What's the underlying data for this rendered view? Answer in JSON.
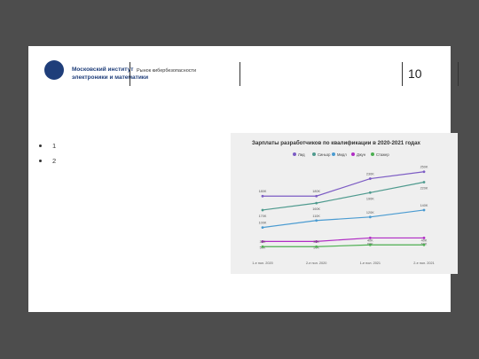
{
  "header": {
    "org_line1": "Московский институт",
    "org_line2": "электроники и математики",
    "topic": "Рынок кибербезопасности",
    "page_number": "10"
  },
  "bullets": [
    "1",
    "2"
  ],
  "chart_data": {
    "type": "line",
    "title": "Зарплаты разработчиков по квалификации в 2020-2021 годах",
    "categories": [
      "1-е пол. 2020",
      "2-е пол. 2020",
      "1-е пол. 2021",
      "2-е пол. 2021"
    ],
    "series": [
      {
        "name": "Лид",
        "color": "#7c5cc4",
        "values": [
          180,
          180,
          230,
          250
        ],
        "labels": [
          "180K",
          "180K",
          "230K",
          "250K"
        ]
      },
      {
        "name": "Синьор",
        "color": "#4e9a8e",
        "values": [
          140,
          160,
          190,
          220
        ],
        "labels": [
          "170K",
          "160K",
          "190K",
          "220K"
        ]
      },
      {
        "name": "Мидл",
        "color": "#4a9bd1",
        "values": [
          90,
          110,
          120,
          140
        ],
        "labels": [
          "100K",
          "110K",
          "120K",
          "140K"
        ]
      },
      {
        "name": "Джун",
        "color": "#b02cc4",
        "values": [
          50,
          50,
          60,
          60
        ],
        "labels": [
          "50K",
          "50K",
          "60K",
          "60K"
        ]
      },
      {
        "name": "Стажер",
        "color": "#4caf50",
        "values": [
          35,
          35,
          40,
          40
        ],
        "labels": [
          "35K",
          "35K",
          "40K",
          "40K"
        ]
      }
    ],
    "ylim": [
      0,
      290
    ],
    "legend": "top-right",
    "grid": false
  }
}
